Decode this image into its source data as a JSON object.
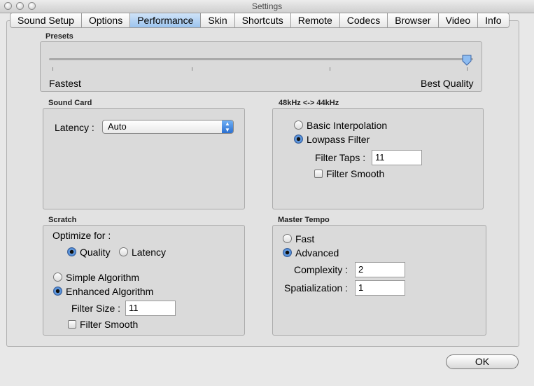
{
  "window": {
    "title": "Settings"
  },
  "tabs": [
    {
      "label": "Sound Setup",
      "active": false
    },
    {
      "label": "Options",
      "active": false
    },
    {
      "label": "Performance",
      "active": true
    },
    {
      "label": "Skin",
      "active": false
    },
    {
      "label": "Shortcuts",
      "active": false
    },
    {
      "label": "Remote",
      "active": false
    },
    {
      "label": "Codecs",
      "active": false
    },
    {
      "label": "Browser",
      "active": false
    },
    {
      "label": "Video",
      "active": false
    },
    {
      "label": "Info",
      "active": false
    }
  ],
  "presets": {
    "label": "Presets",
    "min_label": "Fastest",
    "max_label": "Best Quality",
    "value_fraction": 1.0
  },
  "sound_card": {
    "label": "Sound Card",
    "latency_label": "Latency :",
    "latency_value": "Auto"
  },
  "resample": {
    "label": "48kHz <-> 44kHz",
    "basic": "Basic Interpolation",
    "lowpass": "Lowpass Filter",
    "selected": "lowpass",
    "filter_taps_label": "Filter Taps :",
    "filter_taps_value": "11",
    "filter_smooth": "Filter Smooth",
    "filter_smooth_checked": false
  },
  "scratch": {
    "label": "Scratch",
    "optimize_label": "Optimize for :",
    "quality": "Quality",
    "latency": "Latency",
    "optimize_selected": "quality",
    "simple": "Simple Algorithm",
    "enhanced": "Enhanced Algorithm",
    "algorithm_selected": "enhanced",
    "filter_size_label": "Filter Size :",
    "filter_size_value": "11",
    "filter_smooth": "Filter Smooth",
    "filter_smooth_checked": false
  },
  "master_tempo": {
    "label": "Master Tempo",
    "fast": "Fast",
    "advanced": "Advanced",
    "selected": "advanced",
    "complexity_label": "Complexity :",
    "complexity_value": "2",
    "spatialization_label": "Spatialization :",
    "spatialization_value": "1"
  },
  "ok_label": "OK",
  "colors": {
    "accent": "#2b6fd0",
    "tab_active": "#9cc4ee"
  }
}
